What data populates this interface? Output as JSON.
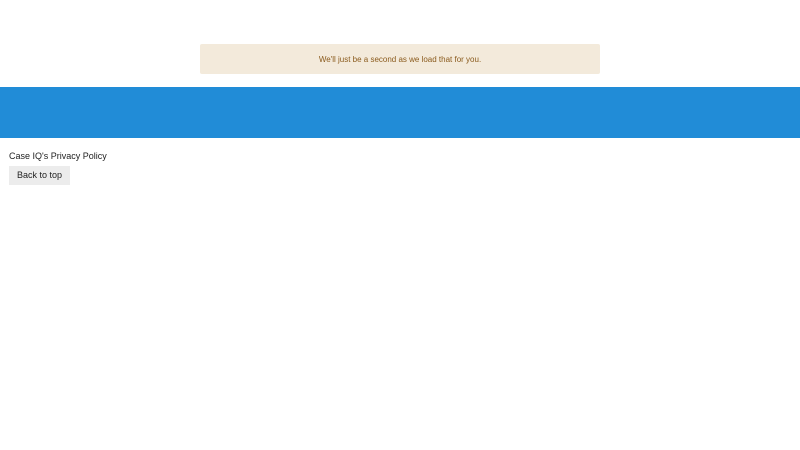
{
  "notice": {
    "loading_text": "We'll just be a second as we load that for you."
  },
  "footer": {
    "privacy_link": "Case IQ's Privacy Policy",
    "back_to_top_label": "Back to top"
  },
  "colors": {
    "banner_background": "#f3eadb",
    "banner_text": "#8a5a1c",
    "band": "#218cd7"
  }
}
